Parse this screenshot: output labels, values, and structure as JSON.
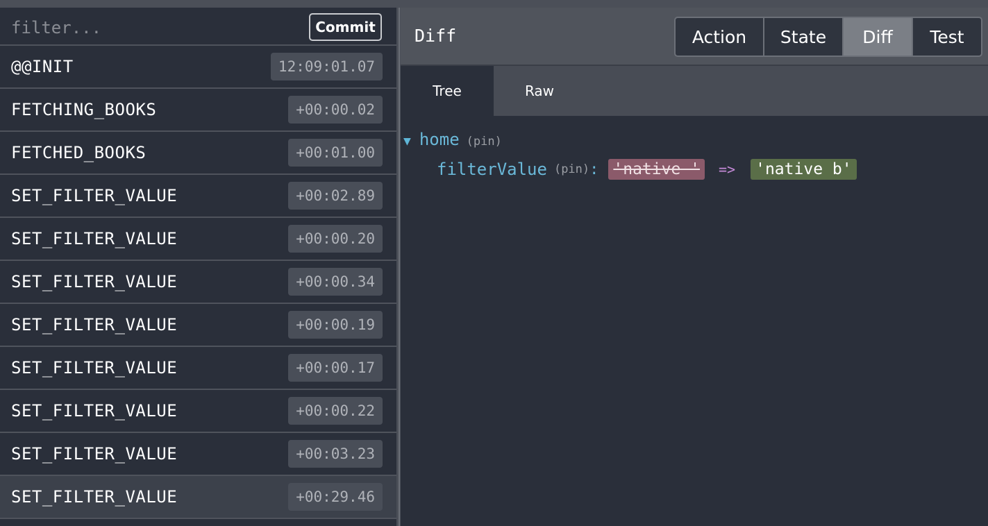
{
  "filter": {
    "placeholder": "filter...",
    "commit_label": "Commit"
  },
  "actions": [
    {
      "name": "@@INIT",
      "time": "12:09:01.07"
    },
    {
      "name": "FETCHING_BOOKS",
      "time": "+00:00.02"
    },
    {
      "name": "FETCHED_BOOKS",
      "time": "+00:01.00"
    },
    {
      "name": "SET_FILTER_VALUE",
      "time": "+00:02.89"
    },
    {
      "name": "SET_FILTER_VALUE",
      "time": "+00:00.20"
    },
    {
      "name": "SET_FILTER_VALUE",
      "time": "+00:00.34"
    },
    {
      "name": "SET_FILTER_VALUE",
      "time": "+00:00.19"
    },
    {
      "name": "SET_FILTER_VALUE",
      "time": "+00:00.17"
    },
    {
      "name": "SET_FILTER_VALUE",
      "time": "+00:00.22"
    },
    {
      "name": "SET_FILTER_VALUE",
      "time": "+00:03.23"
    },
    {
      "name": "SET_FILTER_VALUE",
      "time": "+00:29.46"
    }
  ],
  "selected_action_index": 10,
  "header": {
    "title": "Diff"
  },
  "monitor_tabs": [
    {
      "label": "Action"
    },
    {
      "label": "State"
    },
    {
      "label": "Diff"
    },
    {
      "label": "Test"
    }
  ],
  "active_monitor_tab": "Diff",
  "subtabs": [
    {
      "label": "Tree"
    },
    {
      "label": "Raw"
    }
  ],
  "active_subtab": "Tree",
  "diff": {
    "root_key": "home",
    "root_pin": "(pin)",
    "caret_icon": "triangle-down-icon",
    "child": {
      "key": "filterValue",
      "pin": "(pin)",
      "colon": ":",
      "old_value": "'native '",
      "arrow": "=>",
      "new_value": "'native b'"
    }
  },
  "colors": {
    "background": "#2a2f3a",
    "key": "#6ab8d8",
    "removed": "#8b5a6a",
    "added": "#5a6e48",
    "arrow": "#c58ad8"
  }
}
